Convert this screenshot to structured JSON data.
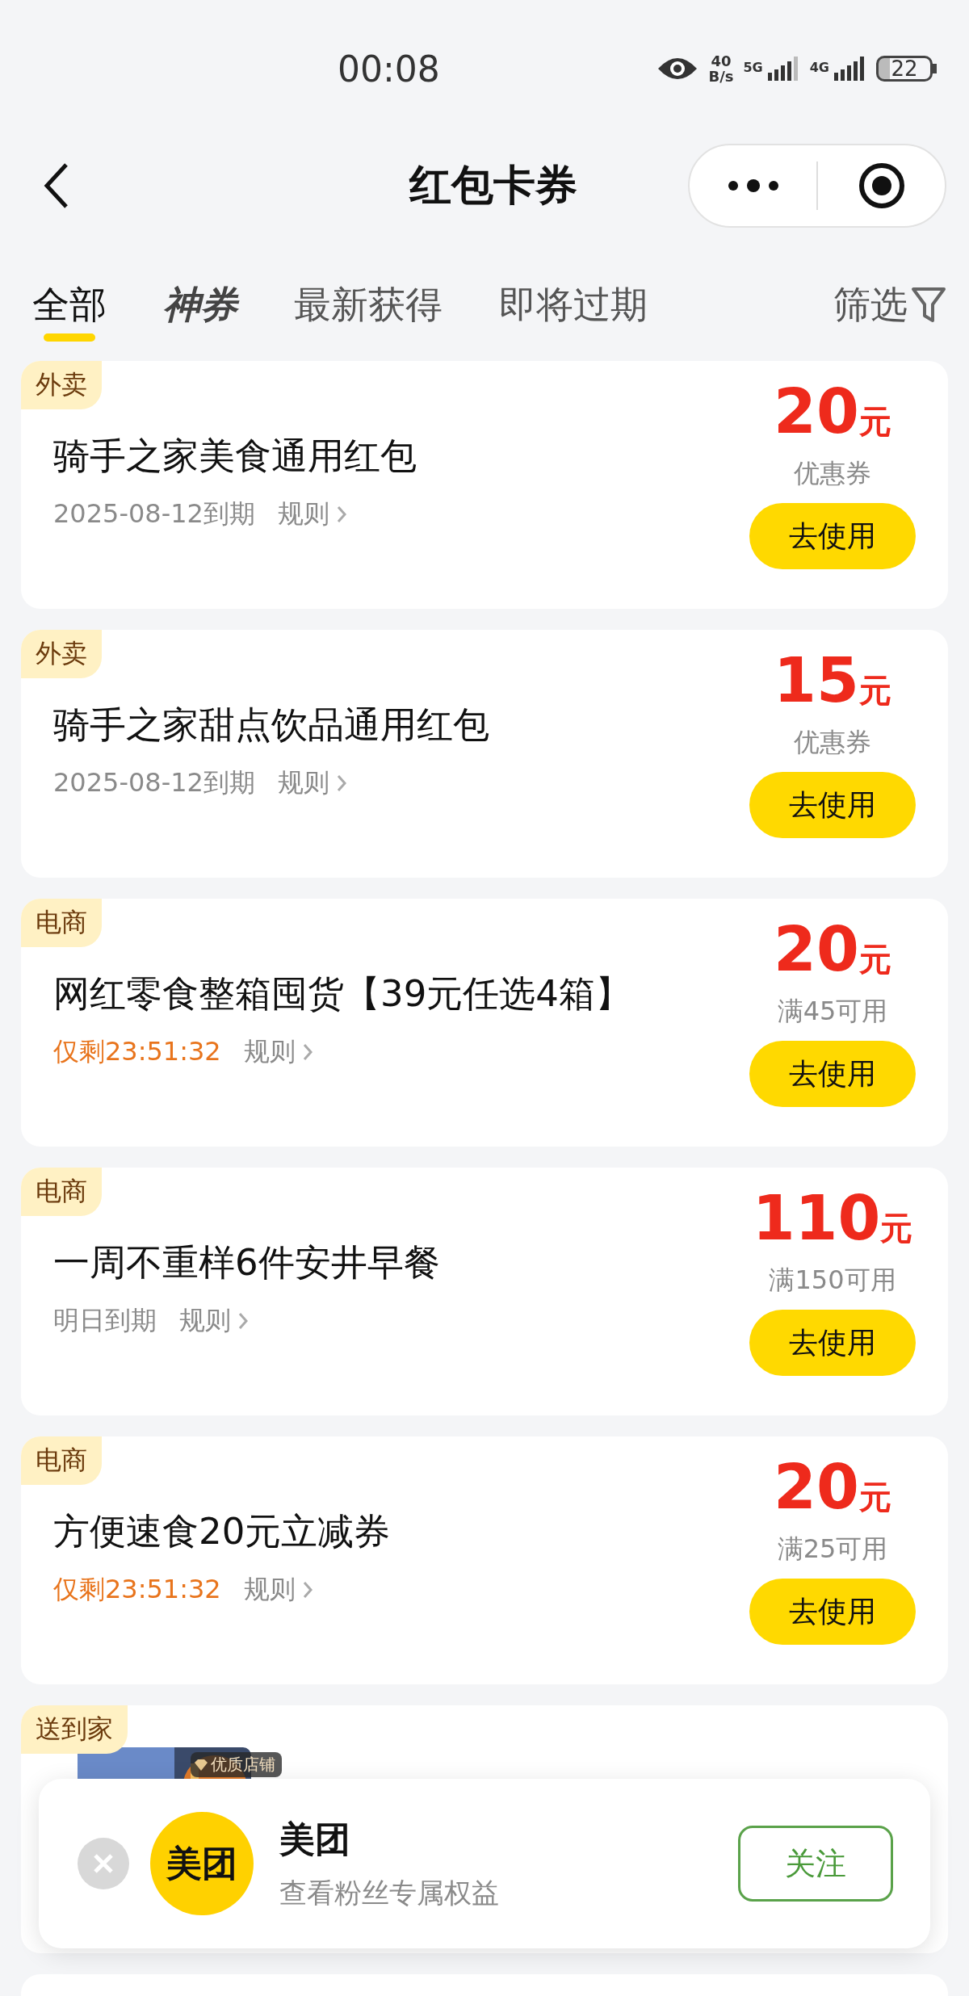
{
  "status_bar": {
    "time": "00:08",
    "net_speed": "40",
    "net_unit": "B/s",
    "sim1": "5G",
    "sim2": "4G",
    "battery": "22"
  },
  "nav": {
    "title": "红包卡券"
  },
  "tabs": [
    {
      "label": "全部",
      "selected": true,
      "kind": "plain"
    },
    {
      "label": "神券",
      "selected": false,
      "kind": "brand"
    },
    {
      "label": "最新获得",
      "selected": false,
      "kind": "plain"
    },
    {
      "label": "即将过期",
      "selected": false,
      "kind": "plain"
    }
  ],
  "filter": {
    "label": "筛选"
  },
  "coupons": [
    {
      "tag": "外卖",
      "title": "骑手之家美食通用红包",
      "expiry": "2025-08-12到期",
      "kind": "date",
      "rule": "规则",
      "amount": "20",
      "unit": "元",
      "condition": "优惠券",
      "button": "去使用"
    },
    {
      "tag": "外卖",
      "title": "骑手之家甜点饮品通用红包",
      "expiry": "2025-08-12到期",
      "kind": "date",
      "rule": "规则",
      "amount": "15",
      "unit": "元",
      "condition": "优惠券",
      "button": "去使用"
    },
    {
      "tag": "电商",
      "title": "网红零食整箱囤货【39元任选4箱】",
      "expiry": "仅剩23:51:32",
      "kind": "countdown",
      "rule": "规则",
      "amount": "20",
      "unit": "元",
      "condition": "满45可用",
      "button": "去使用"
    },
    {
      "tag": "电商",
      "title": "一周不重样6件安井早餐",
      "expiry": "明日到期",
      "kind": "date",
      "rule": "规则",
      "amount": "110",
      "unit": "元",
      "condition": "满150可用",
      "button": "去使用"
    },
    {
      "tag": "电商",
      "title": "方便速食20元立减券",
      "expiry": "仅剩23:51:32",
      "kind": "countdown",
      "rule": "规则",
      "amount": "20",
      "unit": "元",
      "condition": "满25可用",
      "button": "去使用"
    }
  ],
  "partial_coupon": {
    "tag": "送到家",
    "badge": "优质店铺",
    "kind": "picture"
  },
  "follow_popup": {
    "logo": "美团",
    "name": "美团",
    "subtitle": "查看粉丝专属权益",
    "button": "关注"
  }
}
